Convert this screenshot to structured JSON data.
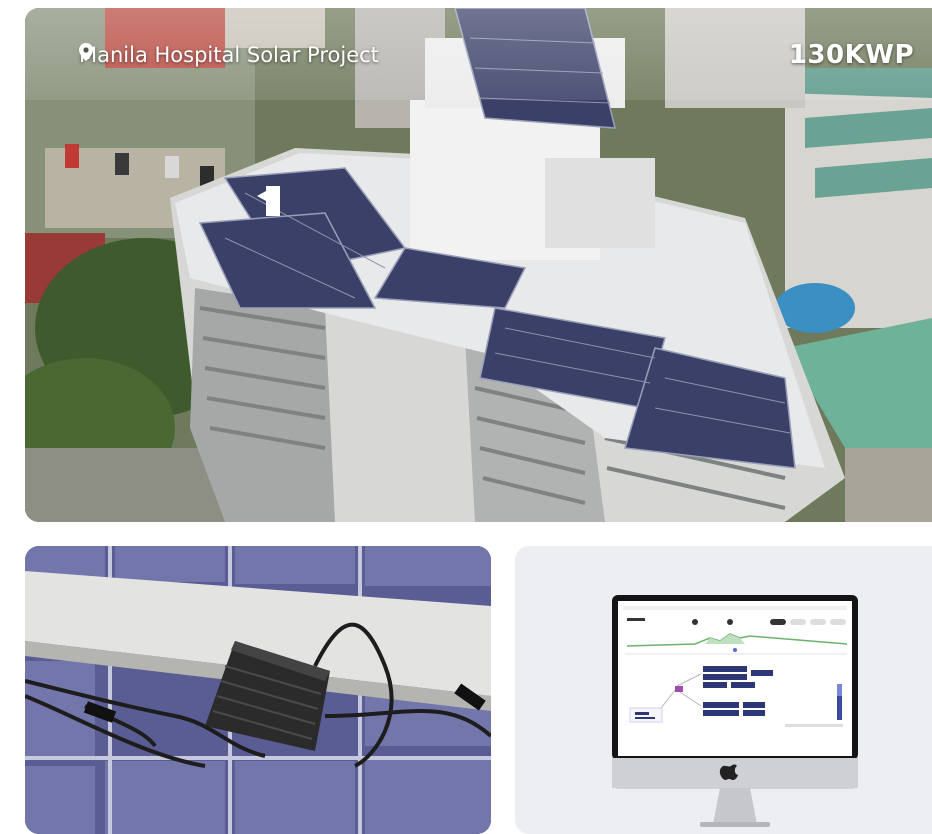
{
  "hero": {
    "location_label": "Manila Hospital Solar Project",
    "capacity_label": "130KWP",
    "location_icon": "map-pin-icon"
  },
  "gallery": {
    "left_card_image": "microinverter-under-panel-photo",
    "right_card_image": "monitoring-dashboard-on-monitor"
  },
  "colors": {
    "overlay_text": "#ffffff",
    "panel_blue": "#3a3f6a",
    "roof_white": "#e7e9ea",
    "card_bg": "#eceef2"
  }
}
